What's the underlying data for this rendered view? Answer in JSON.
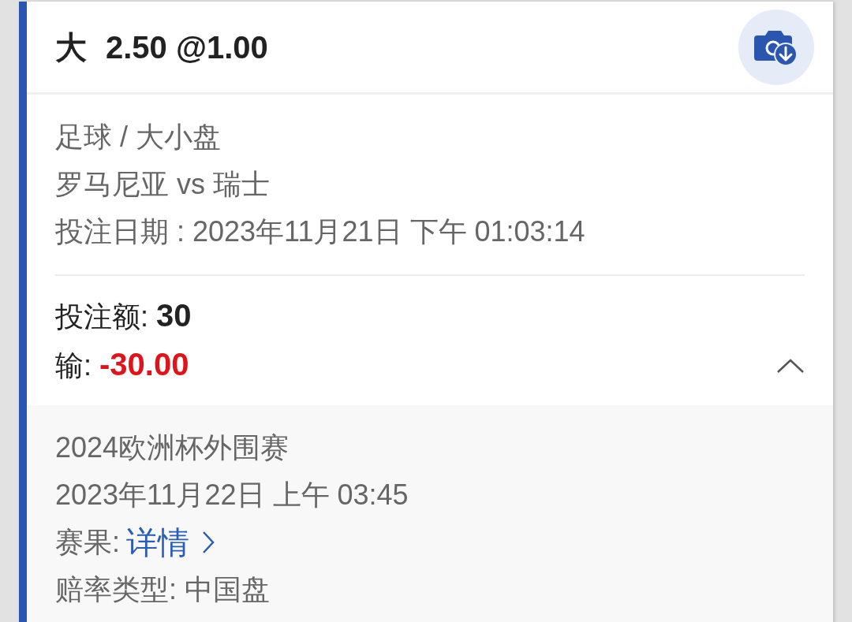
{
  "header": {
    "selection": "大",
    "line": "2.50 @1.00"
  },
  "info": [
    "足球 / 大小盘",
    "罗马尼亚 vs 瑞士",
    "投注日期 : 2023年11月21日 下午 01:03:14"
  ],
  "stake": {
    "label": "投注额:",
    "value": "30"
  },
  "result": {
    "label": "输:",
    "value": "-30.00"
  },
  "expanded": true,
  "details": [
    {
      "kind": "text",
      "text": "2024欧洲杯外围赛"
    },
    {
      "kind": "text",
      "text": "2023年11月22日 上午 03:45"
    },
    {
      "kind": "link",
      "label": "赛果:",
      "link": "详情"
    },
    {
      "kind": "text",
      "text": "赔率类型: 中国盘"
    }
  ]
}
